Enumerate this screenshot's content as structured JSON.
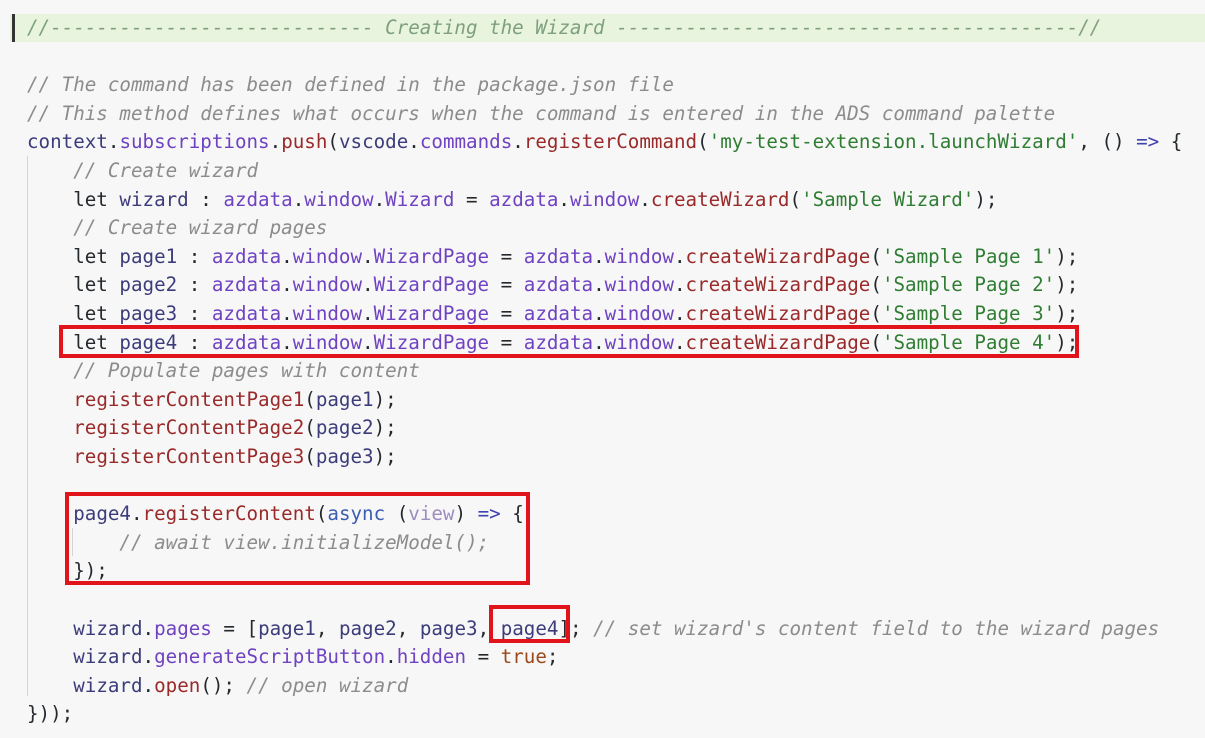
{
  "lines": [
    {
      "tokens": [
        {
          "c": "hc",
          "t": "//---------------------------- Creating the Wizard ----------------------------------------//"
        }
      ]
    },
    {
      "tokens": []
    },
    {
      "tokens": [
        {
          "c": "c",
          "t": "// The command has been defined in the package.json file"
        }
      ]
    },
    {
      "tokens": [
        {
          "c": "c",
          "t": "// This method defines what occurs when the command is entered in the ADS command palette"
        }
      ]
    },
    {
      "tokens": [
        {
          "c": "v",
          "t": "context"
        },
        {
          "c": "t",
          "t": "."
        },
        {
          "c": "p",
          "t": "subscriptions"
        },
        {
          "c": "t",
          "t": "."
        },
        {
          "c": "f",
          "t": "push"
        },
        {
          "c": "t",
          "t": "("
        },
        {
          "c": "v",
          "t": "vscode"
        },
        {
          "c": "t",
          "t": "."
        },
        {
          "c": "p",
          "t": "commands"
        },
        {
          "c": "t",
          "t": "."
        },
        {
          "c": "f",
          "t": "registerCommand"
        },
        {
          "c": "t",
          "t": "("
        },
        {
          "c": "s",
          "t": "'my-test-extension.launchWizard'"
        },
        {
          "c": "t",
          "t": ", () "
        },
        {
          "c": "o",
          "t": "=>"
        },
        {
          "c": "t",
          "t": " {"
        }
      ]
    },
    {
      "tokens": [
        {
          "c": "t",
          "t": "    "
        },
        {
          "c": "c",
          "t": "// Create wizard"
        }
      ]
    },
    {
      "tokens": [
        {
          "c": "t",
          "t": "    let "
        },
        {
          "c": "v",
          "t": "wizard"
        },
        {
          "c": "t",
          "t": " : "
        },
        {
          "c": "p",
          "t": "azdata"
        },
        {
          "c": "t",
          "t": "."
        },
        {
          "c": "p",
          "t": "window"
        },
        {
          "c": "t",
          "t": "."
        },
        {
          "c": "p",
          "t": "Wizard"
        },
        {
          "c": "t",
          "t": " = "
        },
        {
          "c": "p",
          "t": "azdata"
        },
        {
          "c": "t",
          "t": "."
        },
        {
          "c": "p",
          "t": "window"
        },
        {
          "c": "t",
          "t": "."
        },
        {
          "c": "f",
          "t": "createWizard"
        },
        {
          "c": "t",
          "t": "("
        },
        {
          "c": "s",
          "t": "'Sample Wizard'"
        },
        {
          "c": "t",
          "t": ");"
        }
      ]
    },
    {
      "tokens": [
        {
          "c": "t",
          "t": "    "
        },
        {
          "c": "c",
          "t": "// Create wizard pages"
        }
      ]
    },
    {
      "tokens": [
        {
          "c": "t",
          "t": "    let "
        },
        {
          "c": "v",
          "t": "page1"
        },
        {
          "c": "t",
          "t": " : "
        },
        {
          "c": "p",
          "t": "azdata"
        },
        {
          "c": "t",
          "t": "."
        },
        {
          "c": "p",
          "t": "window"
        },
        {
          "c": "t",
          "t": "."
        },
        {
          "c": "p",
          "t": "WizardPage"
        },
        {
          "c": "t",
          "t": " = "
        },
        {
          "c": "p",
          "t": "azdata"
        },
        {
          "c": "t",
          "t": "."
        },
        {
          "c": "p",
          "t": "window"
        },
        {
          "c": "t",
          "t": "."
        },
        {
          "c": "f",
          "t": "createWizardPage"
        },
        {
          "c": "t",
          "t": "("
        },
        {
          "c": "s",
          "t": "'Sample Page 1'"
        },
        {
          "c": "t",
          "t": ");"
        }
      ]
    },
    {
      "tokens": [
        {
          "c": "t",
          "t": "    let "
        },
        {
          "c": "v",
          "t": "page2"
        },
        {
          "c": "t",
          "t": " : "
        },
        {
          "c": "p",
          "t": "azdata"
        },
        {
          "c": "t",
          "t": "."
        },
        {
          "c": "p",
          "t": "window"
        },
        {
          "c": "t",
          "t": "."
        },
        {
          "c": "p",
          "t": "WizardPage"
        },
        {
          "c": "t",
          "t": " = "
        },
        {
          "c": "p",
          "t": "azdata"
        },
        {
          "c": "t",
          "t": "."
        },
        {
          "c": "p",
          "t": "window"
        },
        {
          "c": "t",
          "t": "."
        },
        {
          "c": "f",
          "t": "createWizardPage"
        },
        {
          "c": "t",
          "t": "("
        },
        {
          "c": "s",
          "t": "'Sample Page 2'"
        },
        {
          "c": "t",
          "t": ");"
        }
      ]
    },
    {
      "tokens": [
        {
          "c": "t",
          "t": "    let "
        },
        {
          "c": "v",
          "t": "page3"
        },
        {
          "c": "t",
          "t": " : "
        },
        {
          "c": "p",
          "t": "azdata"
        },
        {
          "c": "t",
          "t": "."
        },
        {
          "c": "p",
          "t": "window"
        },
        {
          "c": "t",
          "t": "."
        },
        {
          "c": "p",
          "t": "WizardPage"
        },
        {
          "c": "t",
          "t": " = "
        },
        {
          "c": "p",
          "t": "azdata"
        },
        {
          "c": "t",
          "t": "."
        },
        {
          "c": "p",
          "t": "window"
        },
        {
          "c": "t",
          "t": "."
        },
        {
          "c": "f",
          "t": "createWizardPage"
        },
        {
          "c": "t",
          "t": "("
        },
        {
          "c": "s",
          "t": "'Sample Page 3'"
        },
        {
          "c": "t",
          "t": ");"
        }
      ]
    },
    {
      "tokens": [
        {
          "c": "t",
          "t": "    let "
        },
        {
          "c": "v",
          "t": "page4"
        },
        {
          "c": "t",
          "t": " : "
        },
        {
          "c": "p",
          "t": "azdata"
        },
        {
          "c": "t",
          "t": "."
        },
        {
          "c": "p",
          "t": "window"
        },
        {
          "c": "t",
          "t": "."
        },
        {
          "c": "p",
          "t": "WizardPage"
        },
        {
          "c": "t",
          "t": " = "
        },
        {
          "c": "p",
          "t": "azdata"
        },
        {
          "c": "t",
          "t": "."
        },
        {
          "c": "p",
          "t": "window"
        },
        {
          "c": "t",
          "t": "."
        },
        {
          "c": "f",
          "t": "createWizardPage"
        },
        {
          "c": "t",
          "t": "("
        },
        {
          "c": "s",
          "t": "'Sample Page 4'"
        },
        {
          "c": "t",
          "t": ");"
        }
      ]
    },
    {
      "tokens": [
        {
          "c": "t",
          "t": "    "
        },
        {
          "c": "c",
          "t": "// Populate pages with content"
        }
      ]
    },
    {
      "tokens": [
        {
          "c": "t",
          "t": "    "
        },
        {
          "c": "f",
          "t": "registerContentPage1"
        },
        {
          "c": "t",
          "t": "("
        },
        {
          "c": "v",
          "t": "page1"
        },
        {
          "c": "t",
          "t": ");"
        }
      ]
    },
    {
      "tokens": [
        {
          "c": "t",
          "t": "    "
        },
        {
          "c": "f",
          "t": "registerContentPage2"
        },
        {
          "c": "t",
          "t": "("
        },
        {
          "c": "v",
          "t": "page2"
        },
        {
          "c": "t",
          "t": ");"
        }
      ]
    },
    {
      "tokens": [
        {
          "c": "t",
          "t": "    "
        },
        {
          "c": "f",
          "t": "registerContentPage3"
        },
        {
          "c": "t",
          "t": "("
        },
        {
          "c": "v",
          "t": "page3"
        },
        {
          "c": "t",
          "t": ");"
        }
      ]
    },
    {
      "tokens": []
    },
    {
      "tokens": [
        {
          "c": "t",
          "t": "    "
        },
        {
          "c": "v",
          "t": "page4"
        },
        {
          "c": "t",
          "t": "."
        },
        {
          "c": "f",
          "t": "registerContent"
        },
        {
          "c": "t",
          "t": "("
        },
        {
          "c": "k",
          "t": "async"
        },
        {
          "c": "t",
          "t": " ("
        },
        {
          "c": "pv",
          "t": "view"
        },
        {
          "c": "t",
          "t": ") "
        },
        {
          "c": "o",
          "t": "=>"
        },
        {
          "c": "t",
          "t": " {"
        }
      ]
    },
    {
      "tokens": [
        {
          "c": "t",
          "t": "        "
        },
        {
          "c": "c",
          "t": "// await view.initializeModel();"
        }
      ]
    },
    {
      "tokens": [
        {
          "c": "t",
          "t": "    });"
        }
      ]
    },
    {
      "tokens": []
    },
    {
      "tokens": [
        {
          "c": "t",
          "t": "    "
        },
        {
          "c": "v",
          "t": "wizard"
        },
        {
          "c": "t",
          "t": "."
        },
        {
          "c": "p",
          "t": "pages"
        },
        {
          "c": "t",
          "t": " = ["
        },
        {
          "c": "v",
          "t": "page1"
        },
        {
          "c": "t",
          "t": ", "
        },
        {
          "c": "v",
          "t": "page2"
        },
        {
          "c": "t",
          "t": ", "
        },
        {
          "c": "v",
          "t": "page3"
        },
        {
          "c": "t",
          "t": ", "
        },
        {
          "c": "v",
          "t": "page4"
        },
        {
          "c": "t",
          "t": "]; "
        },
        {
          "c": "c",
          "t": "// set wizard's content field to the wizard pages"
        }
      ]
    },
    {
      "tokens": [
        {
          "c": "t",
          "t": "    "
        },
        {
          "c": "v",
          "t": "wizard"
        },
        {
          "c": "t",
          "t": "."
        },
        {
          "c": "p",
          "t": "generateScriptButton"
        },
        {
          "c": "t",
          "t": "."
        },
        {
          "c": "p",
          "t": "hidden"
        },
        {
          "c": "t",
          "t": " = "
        },
        {
          "c": "b",
          "t": "true"
        },
        {
          "c": "t",
          "t": ";"
        }
      ]
    },
    {
      "tokens": [
        {
          "c": "t",
          "t": "    "
        },
        {
          "c": "v",
          "t": "wizard"
        },
        {
          "c": "t",
          "t": "."
        },
        {
          "c": "f",
          "t": "open"
        },
        {
          "c": "t",
          "t": "(); "
        },
        {
          "c": "c",
          "t": "// open wizard"
        }
      ]
    },
    {
      "tokens": [
        {
          "c": "t",
          "t": "}));"
        }
      ]
    }
  ]
}
